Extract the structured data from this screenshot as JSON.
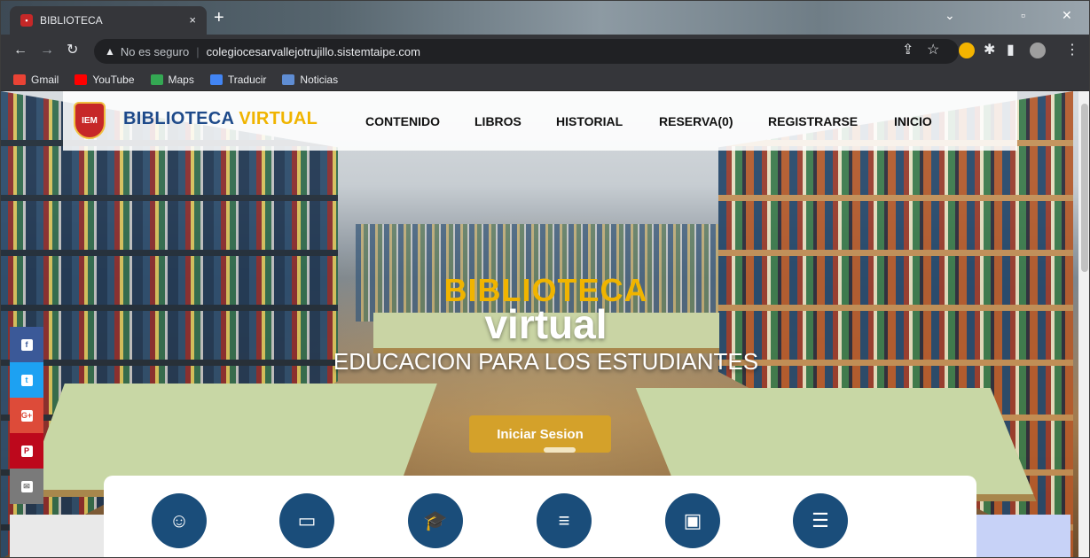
{
  "browser": {
    "tab_title": "BIBLIOTECA",
    "tab_close": "×",
    "new_tab": "+",
    "insecure_label": "No es seguro",
    "url": "colegiocesarvallejotrujillo.sistemtaipe.com",
    "bookmarks": [
      {
        "label": "Gmail",
        "icon": "gmail-icon",
        "color": "#ea4335"
      },
      {
        "label": "YouTube",
        "icon": "youtube-icon",
        "color": "#ff0000"
      },
      {
        "label": "Maps",
        "icon": "maps-icon",
        "color": "#34a853"
      },
      {
        "label": "Traducir",
        "icon": "translate-icon",
        "color": "#4285f4"
      },
      {
        "label": "Noticias",
        "icon": "news-icon",
        "color": "#5f8dd3"
      }
    ]
  },
  "site": {
    "brand_part1": "BIBLIOTECA",
    "brand_part2": "VIRTUAL",
    "logo_text": "IEM",
    "menu": [
      "CONTENIDO",
      "LIBROS",
      "HISTORIAL",
      "RESERVA(0)",
      "REGISTRARSE",
      "INICIO"
    ]
  },
  "hero": {
    "line1": "BIBLIOTECA",
    "line2": "virtual",
    "line3": "EDUCACION PARA LOS ESTUDIANTES",
    "cta": "Iniciar Sesion"
  },
  "social": [
    {
      "name": "facebook-icon",
      "glyph": "f",
      "color": "#3b5998"
    },
    {
      "name": "twitter-icon",
      "glyph": "t",
      "color": "#1da1f2"
    },
    {
      "name": "google-plus-icon",
      "glyph": "G+",
      "color": "#dd4b39"
    },
    {
      "name": "pinterest-icon",
      "glyph": "P",
      "color": "#bd081c"
    },
    {
      "name": "email-icon",
      "glyph": "✉",
      "color": "#7a7a7a"
    }
  ],
  "features": [
    {
      "name": "teacher-icon",
      "glyph": "☺"
    },
    {
      "name": "reserved-icon",
      "glyph": "▭"
    },
    {
      "name": "graduate-icon",
      "glyph": "🎓"
    },
    {
      "name": "books-icon",
      "glyph": "≡"
    },
    {
      "name": "wallet-icon",
      "glyph": "▣"
    },
    {
      "name": "message-icon",
      "glyph": "☰"
    }
  ]
}
